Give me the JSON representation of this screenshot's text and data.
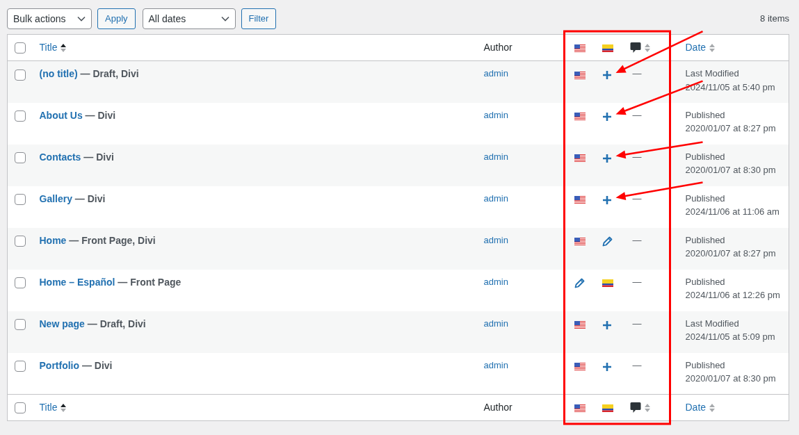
{
  "toolbar": {
    "bulk_actions": "Bulk actions",
    "apply": "Apply",
    "dates": "All dates",
    "filter": "Filter",
    "count": "8 items"
  },
  "header": {
    "checked": false,
    "title": "Title",
    "title_sorted": true,
    "author": "Author",
    "languages": [
      {
        "kind": "us"
      },
      {
        "kind": "co"
      }
    ],
    "date": "Date",
    "date_sorted": false
  },
  "rows": [
    {
      "checked": false,
      "title": "(no title)",
      "states": " — Draft, Divi",
      "author": "admin",
      "translations": [
        {
          "kind": "flag"
        },
        {
          "kind": "add"
        }
      ],
      "comments": "—",
      "date_status": "Last Modified",
      "date": "2024/11/05 at 5:40 pm",
      "arrow": true
    },
    {
      "checked": false,
      "title": "About Us",
      "states": " — Divi",
      "author": "admin",
      "translations": [
        {
          "kind": "flag"
        },
        {
          "kind": "add"
        }
      ],
      "comments": "—",
      "date_status": "Published",
      "date": "2020/01/07 at 8:27 pm",
      "arrow": true
    },
    {
      "checked": false,
      "title": "Contacts",
      "states": " — Divi",
      "author": "admin",
      "translations": [
        {
          "kind": "flag"
        },
        {
          "kind": "add"
        }
      ],
      "comments": "—",
      "date_status": "Published",
      "date": "2020/01/07 at 8:30 pm",
      "arrow": true
    },
    {
      "checked": false,
      "title": "Gallery",
      "states": " — Divi",
      "author": "admin",
      "translations": [
        {
          "kind": "flag"
        },
        {
          "kind": "add"
        }
      ],
      "comments": "—",
      "date_status": "Published",
      "date": "2024/11/06 at 11:06 am",
      "arrow": true
    },
    {
      "checked": false,
      "title": "Home",
      "states": " — Front Page, Divi",
      "author": "admin",
      "translations": [
        {
          "kind": "flag"
        },
        {
          "kind": "edit"
        }
      ],
      "comments": "—",
      "date_status": "Published",
      "date": "2020/01/07 at 8:27 pm",
      "arrow": false
    },
    {
      "checked": false,
      "title": "Home – Español",
      "states": " — Front Page",
      "author": "admin",
      "translations": [
        {
          "kind": "edit"
        },
        {
          "kind": "flag"
        }
      ],
      "comments": "—",
      "date_status": "Published",
      "date": "2024/11/06 at 12:26 pm",
      "arrow": false
    },
    {
      "checked": false,
      "title": "New page",
      "states": " — Draft, Divi",
      "author": "admin",
      "translations": [
        {
          "kind": "flag"
        },
        {
          "kind": "add"
        }
      ],
      "comments": "—",
      "date_status": "Last Modified",
      "date": "2024/11/05 at 5:09 pm",
      "arrow": false
    },
    {
      "checked": false,
      "title": "Portfolio",
      "states": " — Divi",
      "author": "admin",
      "translations": [
        {
          "kind": "flag"
        },
        {
          "kind": "add"
        }
      ],
      "comments": "—",
      "date_status": "Published",
      "date": "2020/01/07 at 8:30 pm",
      "arrow": false
    }
  ],
  "footer": {
    "checked": false,
    "title": "Title",
    "title_sorted": true,
    "author": "Author",
    "languages": [
      {
        "kind": "us"
      },
      {
        "kind": "co"
      }
    ],
    "date": "Date",
    "date_sorted": false
  }
}
